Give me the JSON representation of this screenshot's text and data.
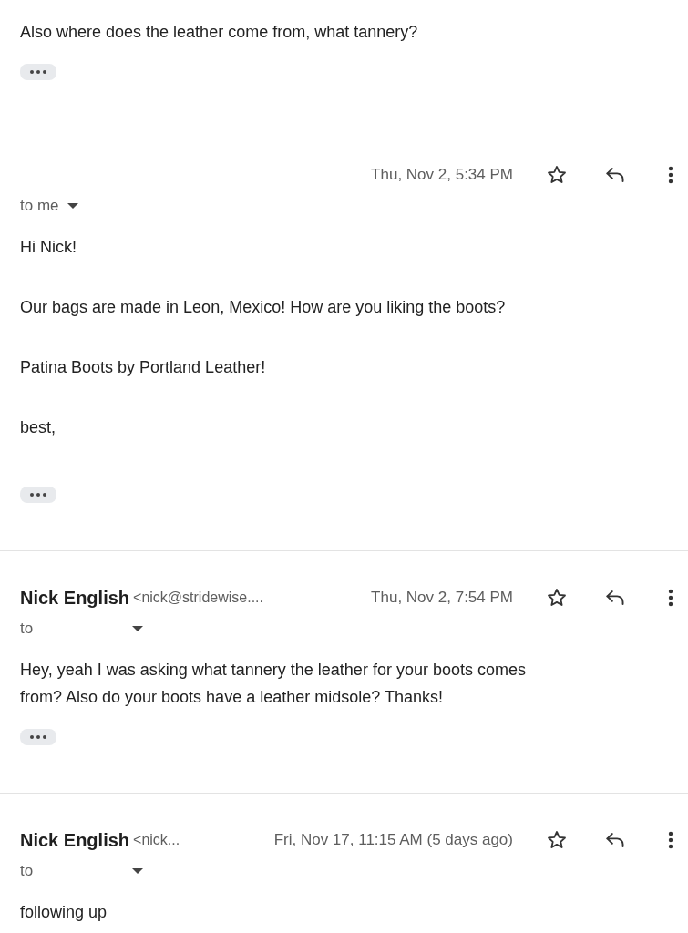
{
  "messages": [
    {
      "paragraphs": [
        [
          "Also where does the leather come from, what tannery?"
        ]
      ],
      "trimmed_content": true
    },
    {
      "header": {
        "date": "Thu, Nov 2, 5:34 PM"
      },
      "recipient": {
        "label": "to me"
      },
      "paragraphs": [
        [
          "Hi Nick!"
        ],
        [
          "Our bags are made in Leon, Mexico! How are you liking the boots?"
        ],
        [
          "Patina Boots by Portland Leather!"
        ],
        [
          "best,"
        ]
      ],
      "trimmed_content": true
    },
    {
      "header": {
        "sender": "Nick English",
        "email": "<nick@stridewise....",
        "date": "Thu, Nov 2, 7:54 PM"
      },
      "recipient": {
        "label": "to"
      },
      "paragraphs": [
        [
          "Hey, yeah I was asking what tannery the leather for your boots comes",
          "from? Also do your boots have a leather midsole? Thanks!"
        ]
      ],
      "trimmed_content": true
    },
    {
      "header": {
        "sender": "Nick English",
        "email": "<nick...",
        "date": "Fri, Nov 17, 11:15 AM (5 days ago)"
      },
      "recipient": {
        "label": "to"
      },
      "paragraphs": [
        [
          "following up"
        ]
      ],
      "trimmed_content": false
    }
  ]
}
